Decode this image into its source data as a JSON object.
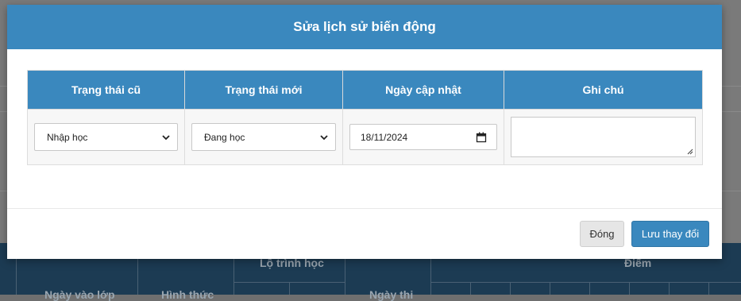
{
  "modal": {
    "title": "Sửa lịch sử biến động",
    "columns": [
      "Trạng thái cũ",
      "Trạng thái mới",
      "Ngày cập nhật",
      "Ghi chú"
    ],
    "row": {
      "old_status": "Nhập học",
      "new_status": "Đang học",
      "update_date": "18/11/2024",
      "note": ""
    },
    "buttons": {
      "close": "Đóng",
      "save": "Lưu thay đổi"
    }
  },
  "background_table": {
    "headers": [
      "Ngày vào lớp",
      "Hình thức",
      "Lộ trình học",
      "Ngày thi",
      "Điểm"
    ]
  },
  "colors": {
    "primary": "#3a88be",
    "background_table": "#1c3b53"
  }
}
